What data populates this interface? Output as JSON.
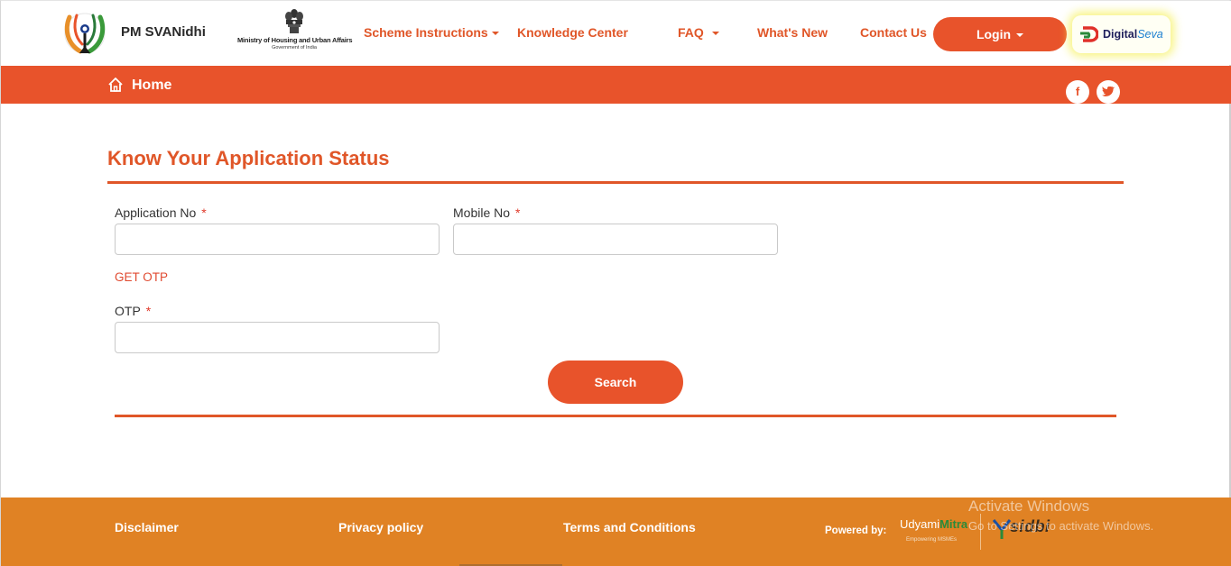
{
  "header": {
    "brand": "PM SVANidhi",
    "ministry_line1": "Ministry of Housing and Urban Affairs",
    "ministry_line2": "Government of India",
    "nav": [
      {
        "label": "Scheme Instructions",
        "has_dropdown": true
      },
      {
        "label": "Knowledge Center",
        "has_dropdown": false
      },
      {
        "label": "FAQ",
        "has_dropdown": true
      },
      {
        "label": "What's New",
        "has_dropdown": false
      },
      {
        "label": "Contact Us",
        "has_dropdown": false
      }
    ],
    "login_label": "Login",
    "digital_seva": {
      "part1": "Digital",
      "part2": "Seva"
    }
  },
  "breadcrumb": {
    "home_label": "Home",
    "icons": [
      "home-icon",
      "facebook-icon",
      "twitter-icon"
    ]
  },
  "form": {
    "title": "Know Your Application Status",
    "application_label": "Application No",
    "application_value": "",
    "mobile_label": "Mobile No",
    "mobile_value": "",
    "required_marker": "*",
    "get_otp_label": "GET OTP",
    "otp_label": "OTP",
    "otp_value": "",
    "search_label": "Search"
  },
  "footer": {
    "links": [
      "Disclaimer",
      "Privacy policy",
      "Terms and Conditions"
    ],
    "powered_by": "Powered by:",
    "udyami_part1": "Udyami",
    "udyami_part2": "Mitra",
    "udyami_tagline": "Empowering MSMEs",
    "sidbi": "sidbi"
  },
  "watermark": {
    "line1": "Activate Windows",
    "line2": "Go to Settings to activate Windows."
  },
  "colors": {
    "accent": "#e8532b",
    "footer": "#e08224",
    "text": "#333333"
  }
}
